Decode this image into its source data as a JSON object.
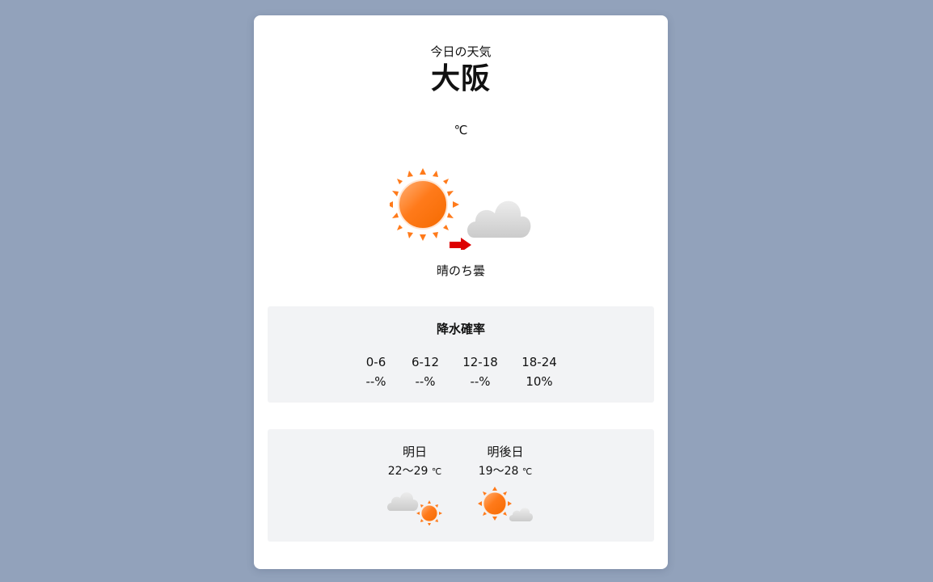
{
  "header": {
    "subtitle": "今日の天気",
    "city": "大阪",
    "temperature": "℃"
  },
  "today": {
    "icon": "sunny-then-cloudy-icon",
    "condition": "晴のち曇"
  },
  "rain": {
    "title": "降水確率",
    "periods": [
      {
        "label": "0-6",
        "value": "--%"
      },
      {
        "label": "6-12",
        "value": "--%"
      },
      {
        "label": "12-18",
        "value": "--%"
      },
      {
        "label": "18-24",
        "value": "10%"
      }
    ]
  },
  "forecast": [
    {
      "label": "明日",
      "temp": "22〜29",
      "unit": "℃",
      "icon": "cloudy-then-sunny-icon"
    },
    {
      "label": "明後日",
      "temp": "19〜28",
      "unit": "℃",
      "icon": "sunny-then-cloudy-icon"
    }
  ],
  "colors": {
    "background": "#92a2bb",
    "card": "#ffffff",
    "panel": "#f2f3f5",
    "sun": "#ff7a1a",
    "cloud": "#d4d4d4",
    "arrow": "#dd0000"
  }
}
